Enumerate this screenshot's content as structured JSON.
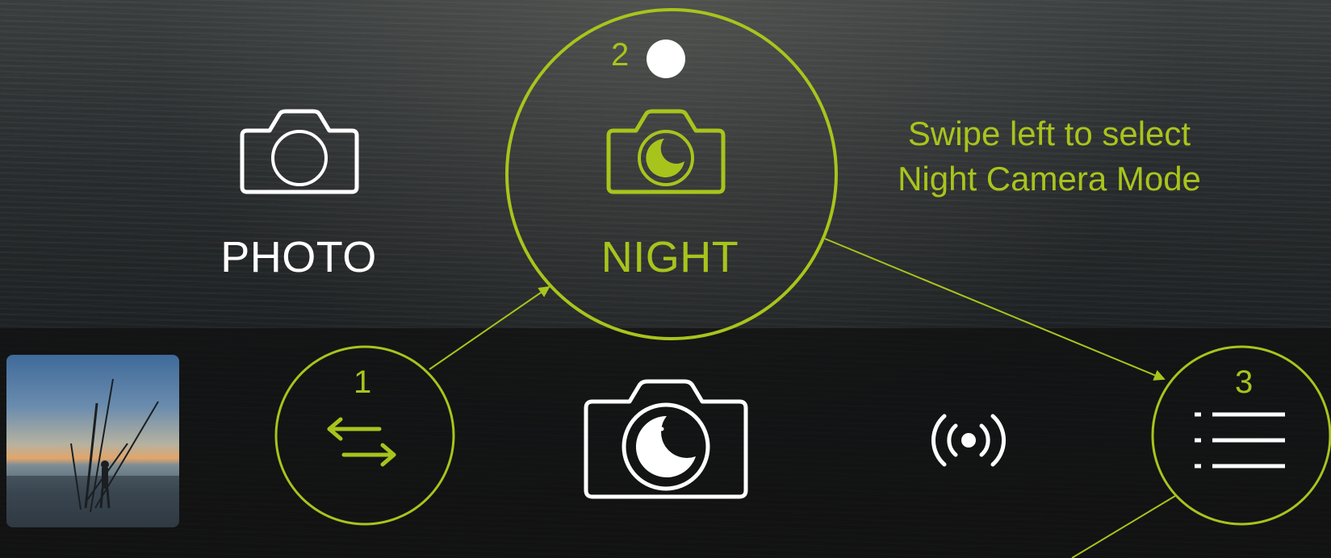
{
  "modes": {
    "photo_label": "PHOTO",
    "night_label": "NIGHT"
  },
  "hint_text": {
    "line1": "Swipe left to select",
    "line2": "Night Camera Mode"
  },
  "steps": {
    "step1": "1",
    "step2": "2",
    "step3": "3"
  },
  "icons": {
    "photo_mode": "camera-icon",
    "night_mode": "night-camera-icon",
    "switch_camera": "swap-arrows-icon",
    "shutter": "night-shutter-icon",
    "live_broadcast": "broadcast-icon",
    "menu": "list-menu-icon",
    "indicator": "dot-indicator-icon"
  },
  "colors": {
    "accent": "#a8c41c",
    "icon_white": "#ffffff",
    "bar_background": "rgba(15,15,15,0.72)"
  }
}
